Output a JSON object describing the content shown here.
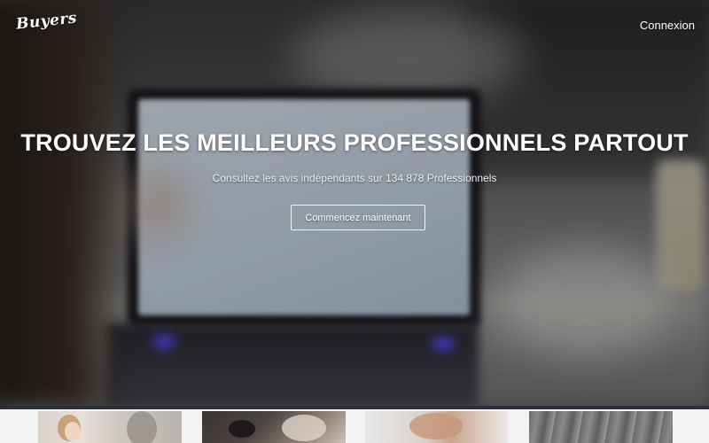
{
  "header": {
    "logo_text": "Buyers",
    "login_label": "Connexion"
  },
  "hero": {
    "title": "TROUVEZ LES MEILLEURS PROFESSIONNELS PARTOUT",
    "subtitle": "Consultez les avis indépendants sur 134 878 Professionnels",
    "cta_label": "Commencez maintenant"
  },
  "thumbnails": [
    {
      "name": "family-photo-thumbnail"
    },
    {
      "name": "hand-tool-thumbnail"
    },
    {
      "name": "hand-desk-thumbnail"
    },
    {
      "name": "fabric-texture-thumbnail"
    }
  ],
  "colors": {
    "hero_text": "#ffffff",
    "strip_border": "#2c2f3a",
    "strip_background": "#f3f3f3"
  }
}
